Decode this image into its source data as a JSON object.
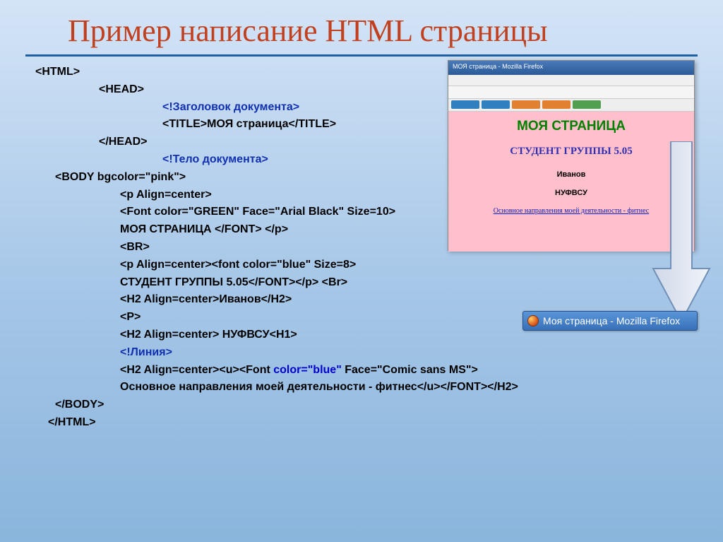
{
  "slide": {
    "title": "Пример написание HTML страницы"
  },
  "code": {
    "l1": "<HTML>",
    "l2": "<HEAD>",
    "l3": "<!Заголовок документа>",
    "l4": "<TITLE>МОЯ страница</TITLE>",
    "l5": "</HEAD>",
    "l6": "<!Тело документа>",
    "l7": "<BODY bgcolor=\"pink\">",
    "l8": "<p Align=center>",
    "l9": "<Font color=\"GREEN\" Face=\"Arial Black\" Size=10>",
    "l10": "МОЯ СТРАНИЦА </FONT> </p>",
    "l11": "<BR>",
    "l12": "<p Align=center><font color=\"blue\" Size=8>",
    "l13": "СТУДЕНТ ГРУППЫ 5.05</FONT></p> <Br>",
    "l14": "<H2 Align=center>Иванов</H2>",
    "l15": "<P>",
    "l16": "<H2 Align=center> НУФВСУ<H1>",
    "l17": "<!Линия>",
    "l18a": "<H2 Align=center><u><Font ",
    "l18b": "color=\"blue\"",
    "l18c": " Face=\"Comic sans MS\">",
    "l19": "Основное направления моей деятельности - фитнес</u></FONT></H2>",
    "l20": "</BODY>",
    "l21": "</HTML>"
  },
  "preview": {
    "win_title": "МОЯ страница - Mozilla Firefox",
    "page_title": "МОЯ СТРАНИЦА",
    "subtitle": "СТУДЕНТ ГРУППЫ 5.05",
    "name": "Иванов",
    "org": "НУФВСУ",
    "link": "Основное направления моей деятельности - фитнес"
  },
  "taskbar": {
    "label": "Моя страница - Mozilla Firefox"
  }
}
